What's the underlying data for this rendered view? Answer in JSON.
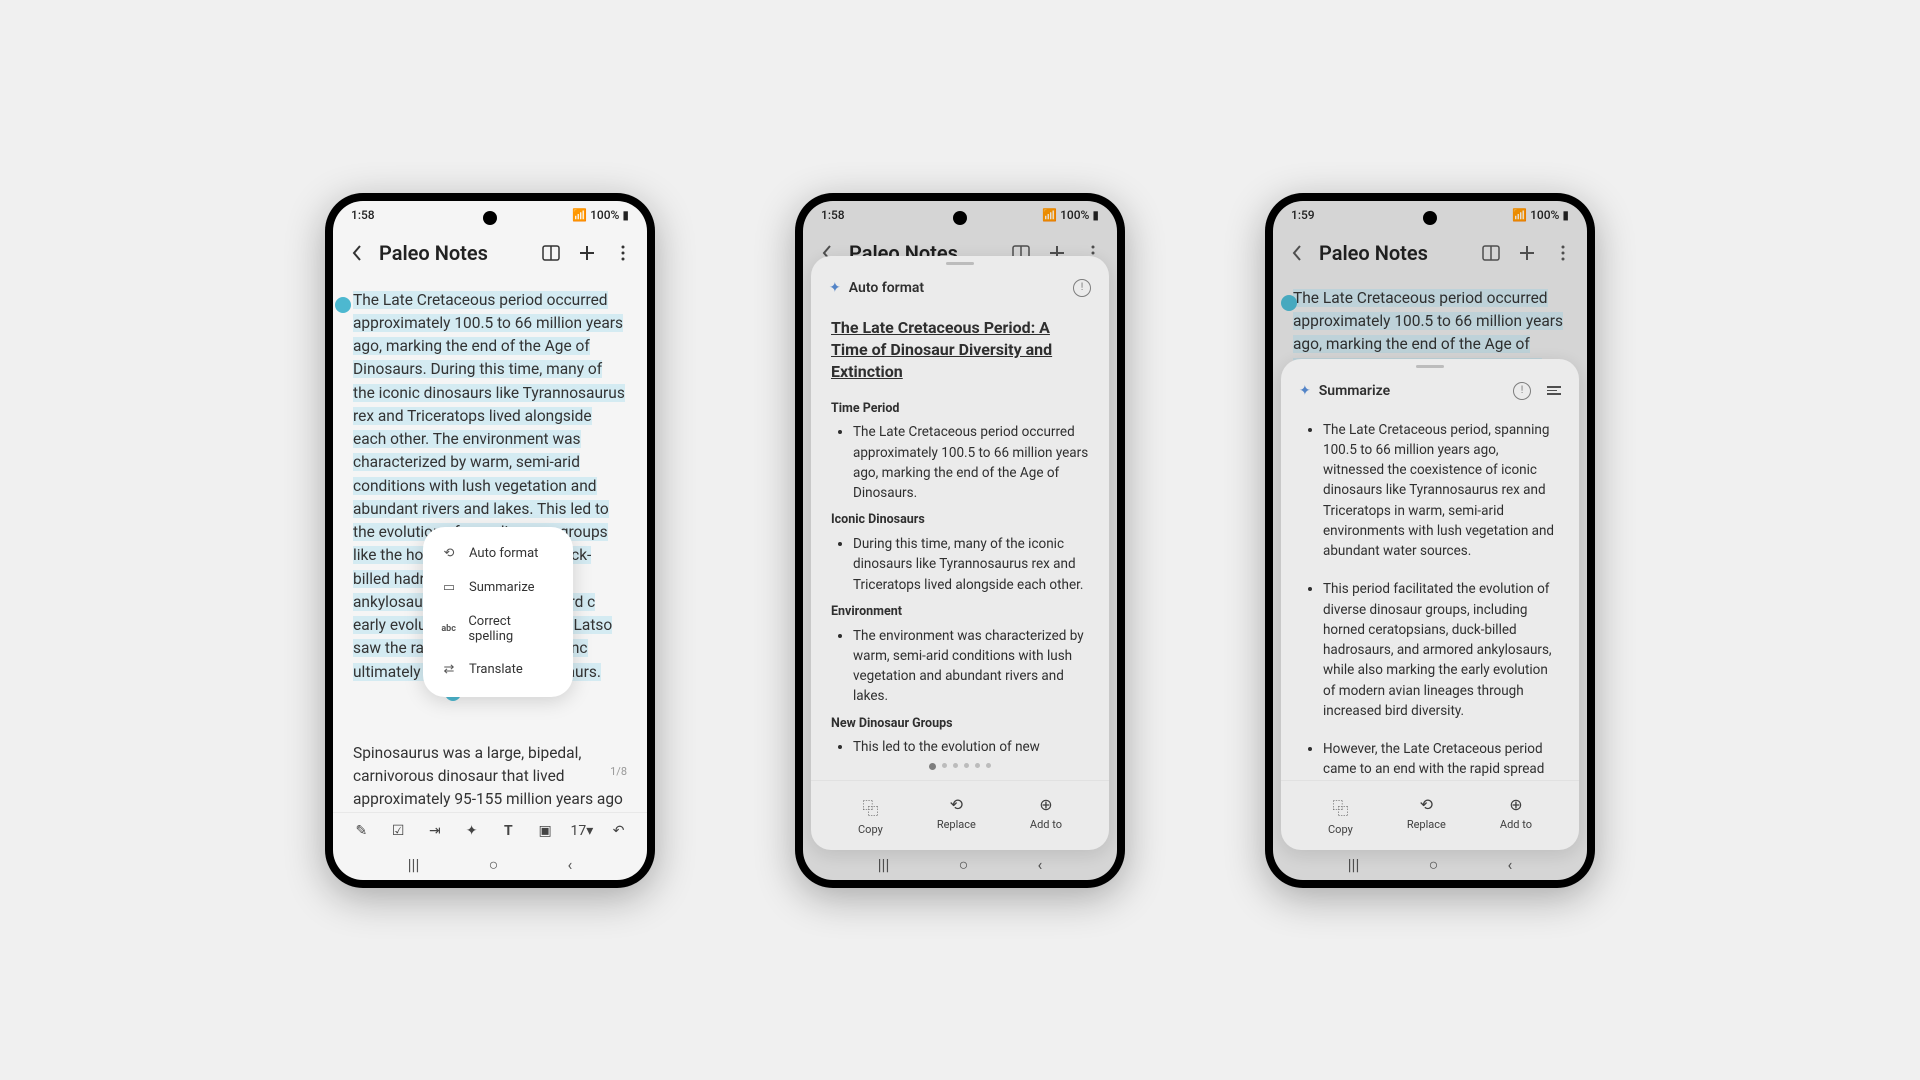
{
  "status": {
    "time1": "1:58",
    "time2": "1:58",
    "time3": "1:59",
    "batt": "100%"
  },
  "header": {
    "title": "Paleo Notes"
  },
  "note": {
    "main": "The Late Cretaceous period occurred approximately 100.5 to 66 million years ago, marking the end of the Age of Dinosaurs. During this time, many of the iconic dinosaurs like Tyrannosaurus rex and Triceratops lived alongside each other. The environment was characterized by warm, semi-arid conditions with lush vegetation and abundant rivers and lakes. This led to the evolution of new dinosaur groups like the horned ceratopsians, duck-billed hadrosaurs, and armored ankylosaurs. Thet increase in bird c early evolution os. However, the Latso saw the rapid sp Paleogene extinc ultimately led to on-avian dinosaurs.",
    "p2": "Spinosaurus was a large, bipedal, carnivorous dinosaur that lived approximately 95-155 million years ago",
    "page": "1/8",
    "short": "The Late Cretaceous period occurred approximately 100.5 to 66 million years ago, marking the end of the Age of Dinosaurs. During this time, many of the"
  },
  "ctx": {
    "a": "Auto format",
    "b": "Summarize",
    "c": "Correct spelling",
    "d": "Translate"
  },
  "toolbar": {
    "size": "17"
  },
  "autoformat": {
    "label": "Auto format",
    "title": "The Late Cretaceous Period: A Time of Dinosaur Diversity and Extinction",
    "s1": {
      "h": "Time Period",
      "li": "The Late Cretaceous period occurred approximately 100.5 to 66 million years ago, marking the end of the Age of Dinosaurs."
    },
    "s2": {
      "h": "Iconic Dinosaurs",
      "li": "During this time, many of the iconic dinosaurs like Tyrannosaurus rex and Triceratops lived alongside each other."
    },
    "s3": {
      "h": "Environment",
      "li": "The environment was characterized by warm, semi-arid conditions with lush vegetation and abundant rivers and lakes."
    },
    "s4": {
      "h": "New Dinosaur Groups",
      "li": "This led to the evolution of new dinosaur groups like the horned ceratopsians,"
    }
  },
  "summarize": {
    "label": "Summarize",
    "b1": "The Late Cretaceous period, spanning 100.5 to 66 million years ago, witnessed the coexistence of iconic dinosaurs like Tyrannosaurus rex and Triceratops in warm, semi-arid environments with lush vegetation and abundant water sources.",
    "b2": "This period facilitated the evolution of diverse dinosaur groups, including horned ceratopsians, duck-billed hadrosaurs, and armored ankylosaurs, while also marking the early evolution of modern avian lineages through increased bird diversity.",
    "b3": "However, the Late Cretaceous period came to an end with the rapid spread of the Cretaceous-Paleogene extinction event, leading to the extinction of non-avian dinosaurs."
  },
  "actions": {
    "copy": "Copy",
    "replace": "Replace",
    "addto": "Add to"
  }
}
